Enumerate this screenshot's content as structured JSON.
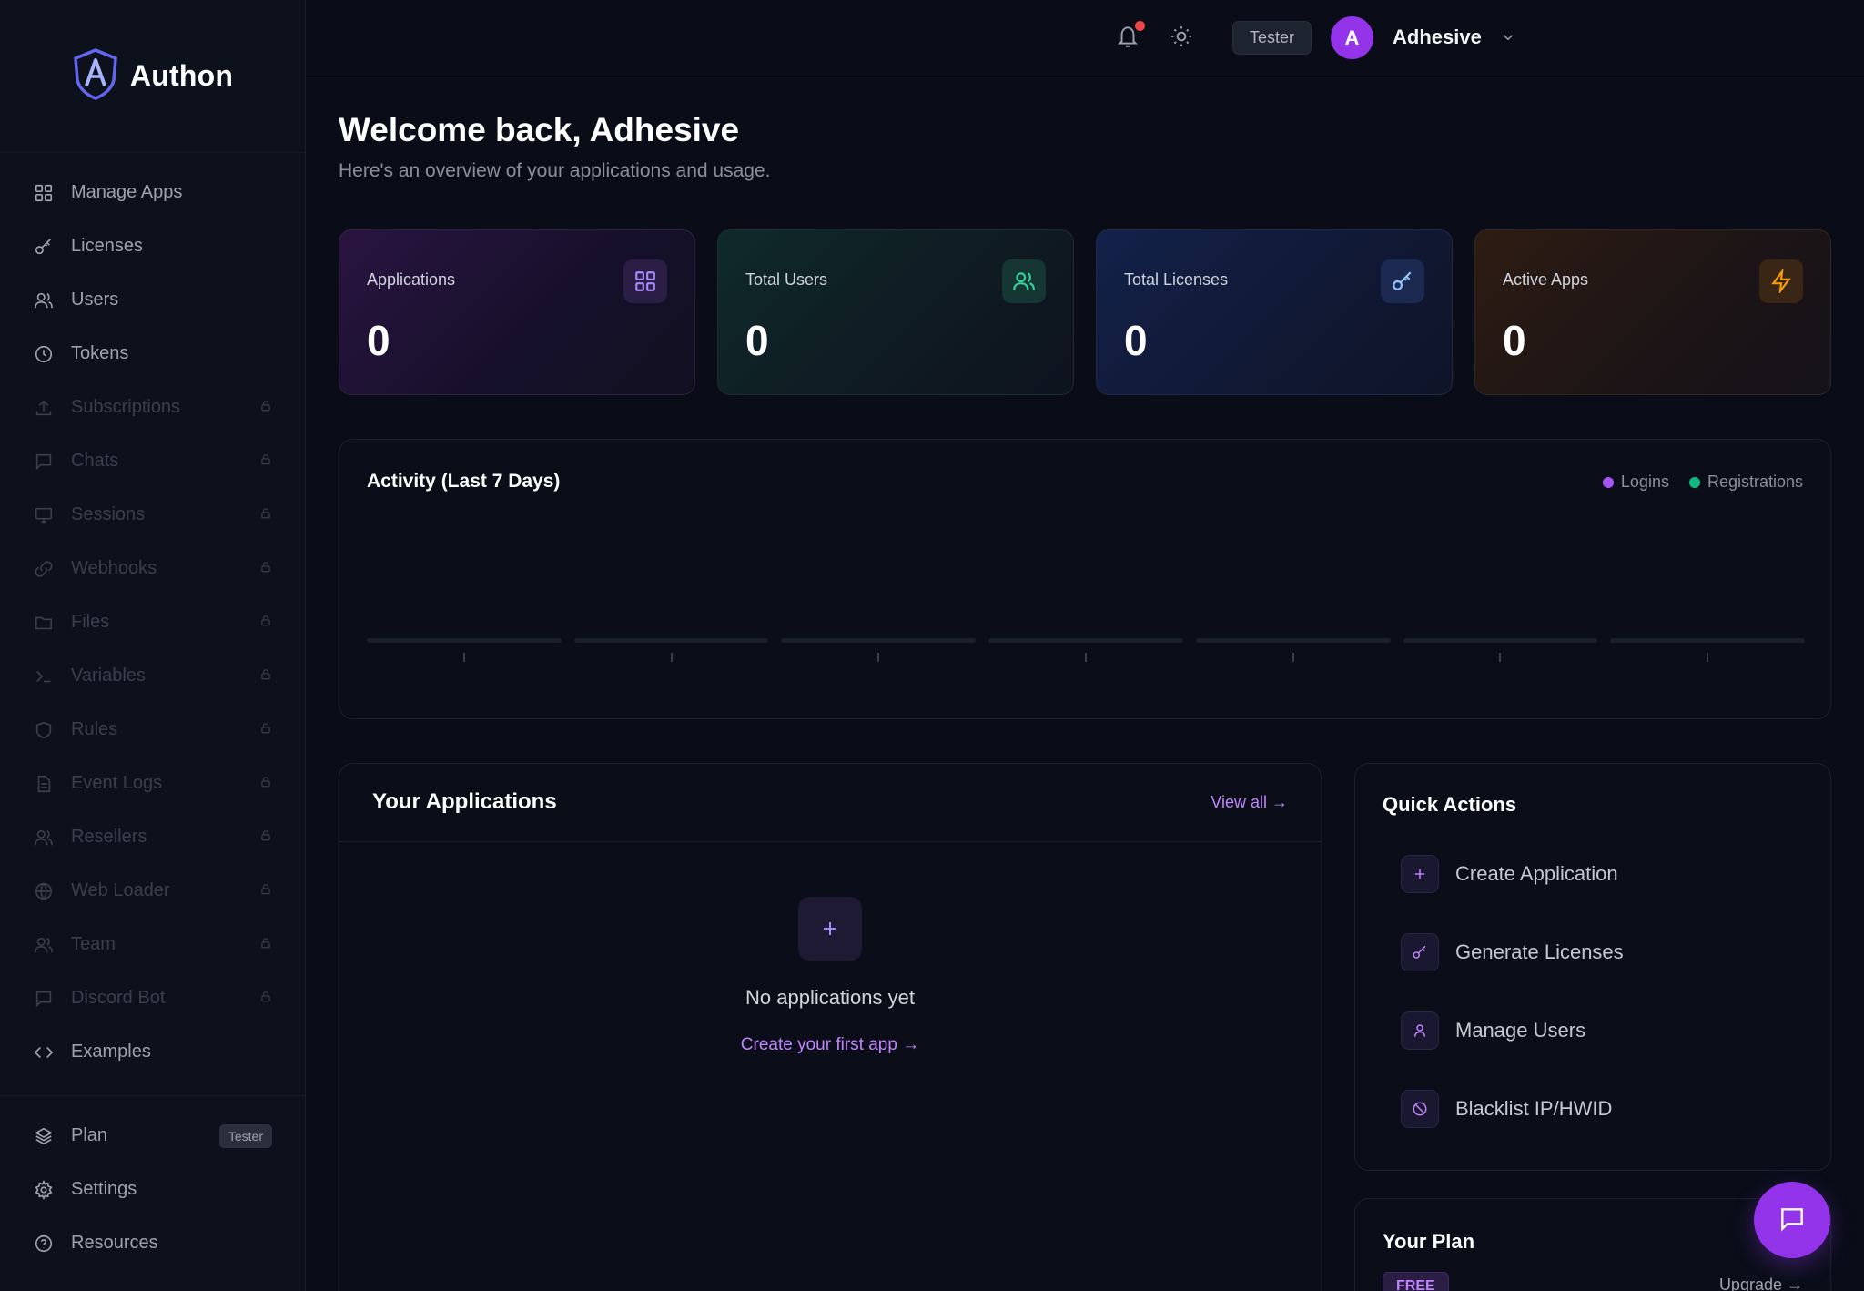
{
  "brand": {
    "name": "Authon"
  },
  "sidebar": {
    "items": [
      {
        "label": "Manage Apps",
        "icon": "grid-icon",
        "locked": false
      },
      {
        "label": "Licenses",
        "icon": "key-icon",
        "locked": false
      },
      {
        "label": "Users",
        "icon": "users-icon",
        "locked": false
      },
      {
        "label": "Tokens",
        "icon": "clock-icon",
        "locked": false
      },
      {
        "label": "Subscriptions",
        "icon": "upload-icon",
        "locked": true
      },
      {
        "label": "Chats",
        "icon": "chat-icon",
        "locked": true
      },
      {
        "label": "Sessions",
        "icon": "monitor-icon",
        "locked": true
      },
      {
        "label": "Webhooks",
        "icon": "link-icon",
        "locked": true
      },
      {
        "label": "Files",
        "icon": "folder-icon",
        "locked": true
      },
      {
        "label": "Variables",
        "icon": "terminal-icon",
        "locked": true
      },
      {
        "label": "Rules",
        "icon": "shield-icon",
        "locked": true
      },
      {
        "label": "Event Logs",
        "icon": "document-icon",
        "locked": true
      },
      {
        "label": "Resellers",
        "icon": "users-icon",
        "locked": true
      },
      {
        "label": "Web Loader",
        "icon": "globe-icon",
        "locked": true
      },
      {
        "label": "Team",
        "icon": "users-icon",
        "locked": true
      },
      {
        "label": "Discord Bot",
        "icon": "chat-icon",
        "locked": true
      },
      {
        "label": "Examples",
        "icon": "code-icon",
        "locked": false
      }
    ],
    "bottom": {
      "plan_label": "Plan",
      "plan_badge": "Tester",
      "settings_label": "Settings",
      "resources_label": "Resources"
    }
  },
  "topbar": {
    "role": "Tester",
    "avatar_initial": "A",
    "user_name": "Adhesive"
  },
  "header": {
    "title": "Welcome back, Adhesive",
    "subtitle": "Here's an overview of your applications and usage."
  },
  "stats": [
    {
      "label": "Applications",
      "value": "0",
      "icon": "grid-icon",
      "color": "#a78bfa"
    },
    {
      "label": "Total Users",
      "value": "0",
      "icon": "users-icon",
      "color": "#34d399"
    },
    {
      "label": "Total Licenses",
      "value": "0",
      "icon": "key-icon",
      "color": "#93c5fd"
    },
    {
      "label": "Active Apps",
      "value": "0",
      "icon": "bolt-icon",
      "color": "#f59e0b"
    }
  ],
  "activity": {
    "title": "Activity (Last 7 Days)",
    "legend": [
      {
        "name": "Logins",
        "color": "#a855f7"
      },
      {
        "name": "Registrations",
        "color": "#10b981"
      }
    ]
  },
  "chart_data": {
    "type": "bar",
    "title": "Activity (Last 7 Days)",
    "series": [
      {
        "name": "Logins",
        "values": [
          0,
          0,
          0,
          0,
          0,
          0,
          0
        ]
      },
      {
        "name": "Registrations",
        "values": [
          0,
          0,
          0,
          0,
          0,
          0,
          0
        ]
      }
    ]
  },
  "applications": {
    "title": "Your Applications",
    "view_all": "View all →",
    "empty_title": "No applications yet",
    "empty_link": "Create your first app →"
  },
  "quick_actions": {
    "title": "Quick Actions",
    "items": [
      {
        "label": "Create Application",
        "icon": "plus-icon"
      },
      {
        "label": "Generate Licenses",
        "icon": "key-icon"
      },
      {
        "label": "Manage Users",
        "icon": "user-icon"
      },
      {
        "label": "Blacklist IP/HWID",
        "icon": "ban-icon"
      }
    ]
  },
  "plan": {
    "title": "Your Plan",
    "badge": "FREE",
    "upgrade": "Upgrade →"
  },
  "colors": {
    "accent": "#9333ea",
    "link": "#c084fc",
    "background": "#0a0d18",
    "notification": "#ef4444"
  }
}
